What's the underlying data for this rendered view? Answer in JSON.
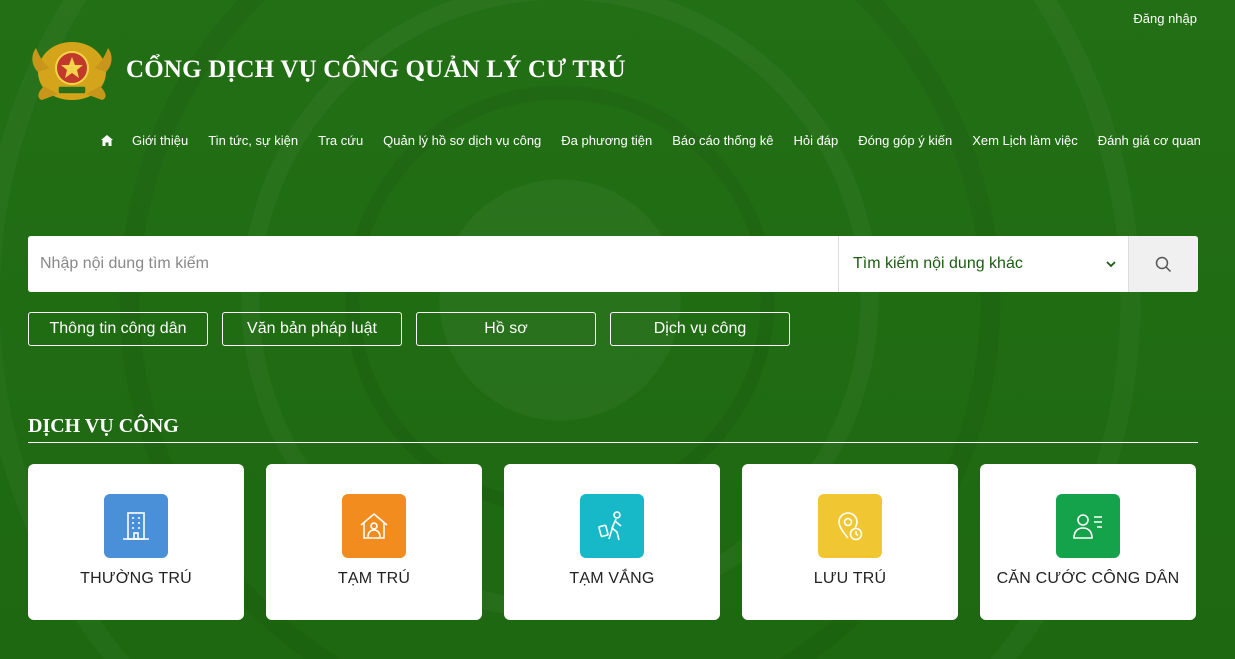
{
  "header": {
    "login_label": "Đăng nhập",
    "title": "CỔNG DỊCH VỤ CÔNG QUẢN LÝ CƯ TRÚ"
  },
  "nav": {
    "home_icon": "home-icon",
    "items": [
      "Giới thiệu",
      "Tin tức, sự kiện",
      "Tra cứu",
      "Quản lý hồ sơ dịch vụ công",
      "Đa phương tiện",
      "Báo cáo thống kê",
      "Hỏi đáp",
      "Đóng góp ý kiến",
      "Xem Lịch làm việc",
      "Đánh giá cơ quan"
    ]
  },
  "search": {
    "placeholder": "Nhập nội dung tìm kiếm",
    "select_value": "Tìm kiếm nội dung khác"
  },
  "quick_links": [
    "Thông tin công dân",
    "Văn bản pháp luật",
    "Hồ sơ",
    "Dịch vụ công"
  ],
  "services": {
    "title": "DỊCH VỤ CÔNG",
    "cards": [
      {
        "label": "THƯỜNG TRÚ",
        "icon": "building-icon",
        "color": "#4a90d9"
      },
      {
        "label": "TẠM TRÚ",
        "icon": "house-person-icon",
        "color": "#f28c1e"
      },
      {
        "label": "TẠM VẮNG",
        "icon": "traveler-icon",
        "color": "#17b9c9"
      },
      {
        "label": "LƯU TRÚ",
        "icon": "location-clock-icon",
        "color": "#f0c733"
      },
      {
        "label": "CĂN CƯỚC CÔNG DÂN",
        "icon": "id-card-icon",
        "color": "#14a24b"
      }
    ]
  },
  "colors": {
    "background": "#1f6b12",
    "select_text": "#1a5c10"
  }
}
